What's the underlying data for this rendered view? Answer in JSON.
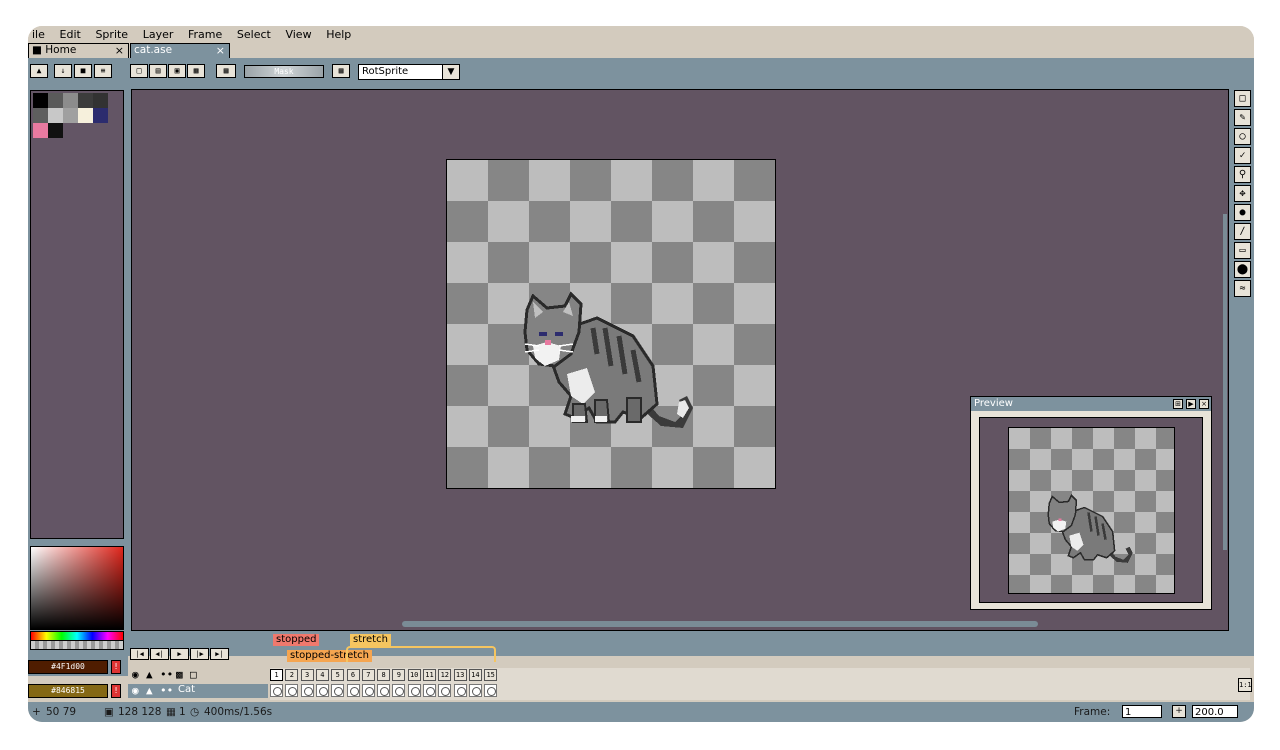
{
  "menu": [
    "File",
    "Edit",
    "Sprite",
    "Layer",
    "Frame",
    "Select",
    "View",
    "Help"
  ],
  "menu_display": [
    "ile",
    "Edit",
    "Sprite",
    "Layer",
    "Frame",
    "Select",
    "View",
    "Help"
  ],
  "tabs": [
    {
      "label": "Home",
      "close": "×",
      "icon": "home-icon"
    },
    {
      "label": "cat.ase",
      "close": "×"
    }
  ],
  "toolbar": {
    "mask_label": "Mask",
    "resize_mode": "RotSprite"
  },
  "palette_colors": [
    "#000000",
    "#5a5a5a",
    "#8c8c8c",
    "#3c3c3c",
    "#323232",
    "#5e5e5e",
    "#c8c8c8",
    "#a0a0a0",
    "#f6f0dc",
    "#2c2c6e",
    "#e87aa0",
    "#111111"
  ],
  "colors": {
    "foreground": "#4f1d00",
    "background": "#846815",
    "foreground_label": "#4F1d00",
    "background_label": "#846815",
    "warning_label": "!"
  },
  "preview": {
    "title": "Preview"
  },
  "tools": [
    "rectangular-marquee-icon",
    "pencil-icon",
    "eraser-icon",
    "eyedropper-icon",
    "zoom-icon",
    "move-icon",
    "paint-bucket-icon",
    "line-icon",
    "rectangle-icon",
    "ellipse-icon",
    "blur-icon"
  ],
  "timeline": {
    "tags": [
      {
        "label": "stopped",
        "color": "#f0796d"
      },
      {
        "label": "stretch",
        "color": "#f5c560"
      },
      {
        "label": "stopped-stretch",
        "color": "#f5a550"
      }
    ],
    "frames": [
      "1",
      "2",
      "3",
      "4",
      "5",
      "6",
      "7",
      "8",
      "9",
      "10",
      "11",
      "12",
      "13",
      "14",
      "15"
    ],
    "layer_name": "Cat",
    "zoom_reset": "1:1"
  },
  "status": {
    "cursor_pos": "50 79",
    "sprite_size": "128 128",
    "frame_count": "1",
    "duration": "400ms/1.56s",
    "frame_label": "Frame:",
    "frame_value": "1",
    "zoom_value": "200.0"
  }
}
